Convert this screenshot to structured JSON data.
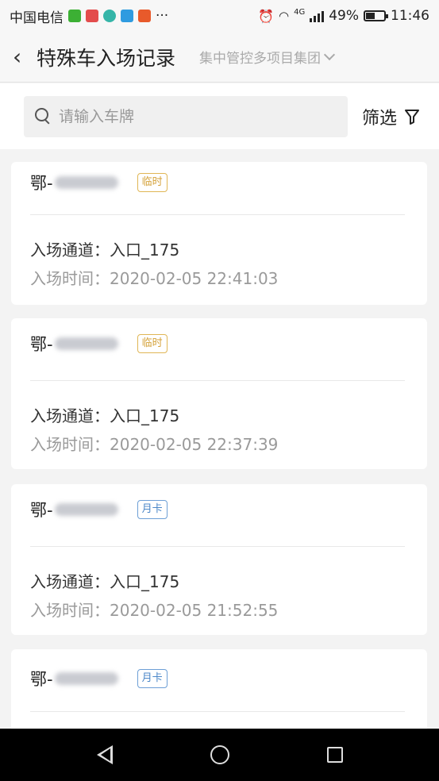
{
  "status_bar": {
    "carrier": "中国电信",
    "notif_more": "···",
    "network": "4G",
    "battery": "49%",
    "time": "11:46"
  },
  "header": {
    "back_icon": "chevron-left-icon",
    "title": "特殊车入场记录",
    "group": "集中管控多项目集团",
    "back_glyph": "‹"
  },
  "search": {
    "placeholder": "请输入车牌",
    "value": "",
    "filter_label": "筛选"
  },
  "records": [
    {
      "plate_prefix": "鄂-",
      "tag": "临时",
      "tag_type": "temp",
      "channel": "入场通道：入口_175",
      "time": "入场时间：2020-02-05 22:41:03"
    },
    {
      "plate_prefix": "鄂-",
      "tag": "临时",
      "tag_type": "temp",
      "channel": "入场通道：入口_175",
      "time": "入场时间：2020-02-05 22:37:39"
    },
    {
      "plate_prefix": "鄂-",
      "tag": "月卡",
      "tag_type": "month",
      "channel": "入场通道：入口_175",
      "time": "入场时间：2020-02-05 21:52:55"
    },
    {
      "plate_prefix": "鄂-",
      "tag": "月卡",
      "tag_type": "month",
      "channel": "",
      "time": ""
    }
  ],
  "colors": {
    "temp_badge": "#d4a23a",
    "month_badge": "#4b87c8",
    "background": "#f3f3f3"
  }
}
